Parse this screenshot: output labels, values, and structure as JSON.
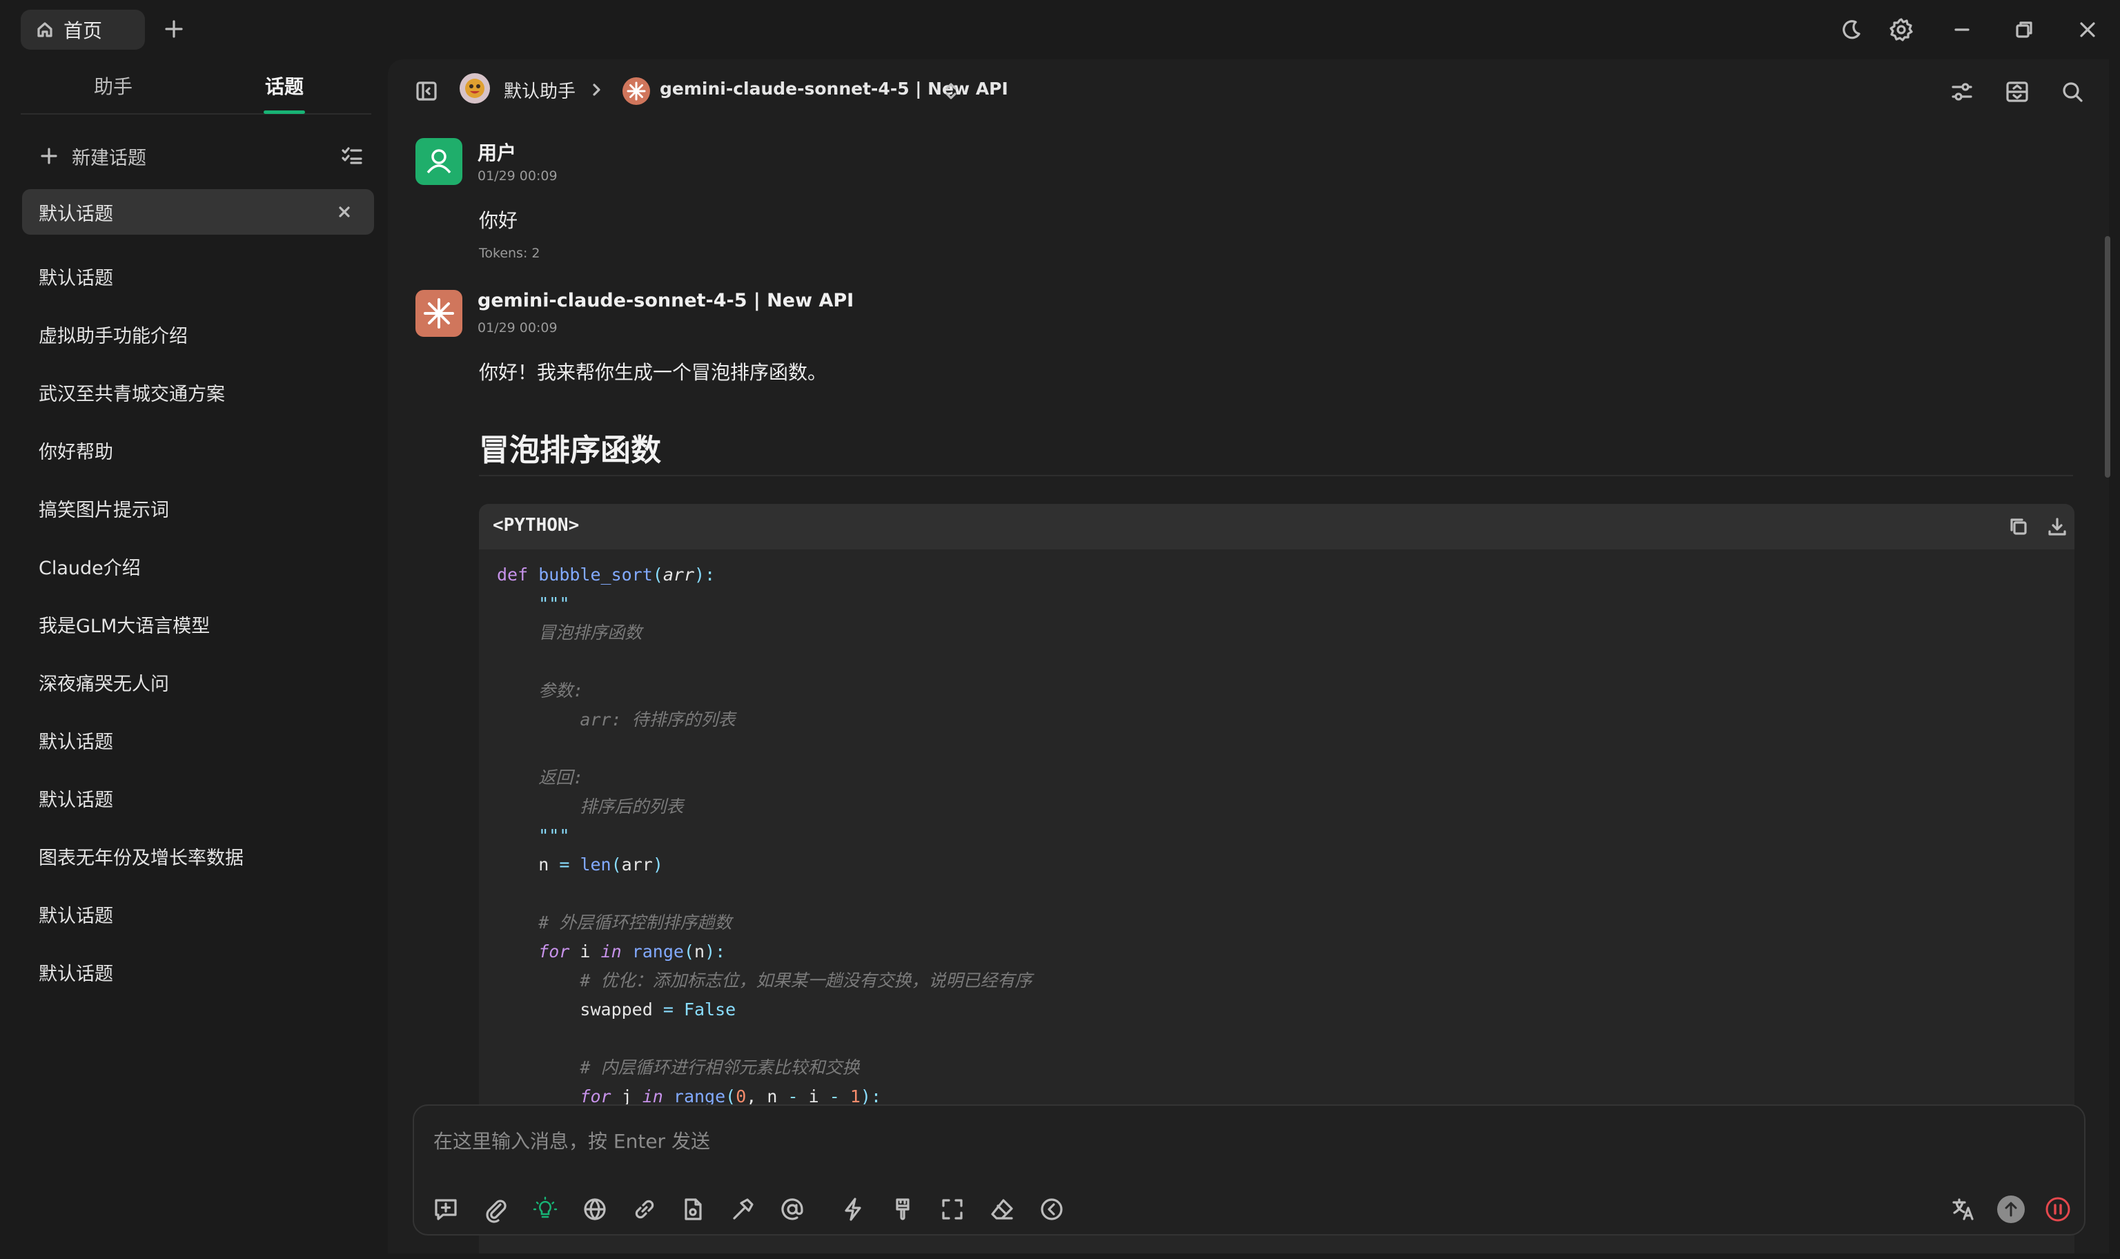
{
  "titlebar": {
    "home_tab_label": "首页",
    "icons": [
      "home-icon",
      "plus-icon",
      "moon-icon",
      "gear-icon",
      "minimize-icon",
      "restore-icon",
      "close-icon"
    ]
  },
  "sidebar": {
    "tabs": [
      {
        "label": "助手"
      },
      {
        "label": "话题",
        "active": true
      }
    ],
    "new_topic_label": "新建话题",
    "topics": [
      {
        "label": "默认话题",
        "active": true
      },
      {
        "label": "默认话题"
      },
      {
        "label": "虚拟助手功能介绍"
      },
      {
        "label": "武汉至共青城交通方案"
      },
      {
        "label": "你好帮助"
      },
      {
        "label": "搞笑图片提示词"
      },
      {
        "label": "Claude介绍"
      },
      {
        "label": "我是GLM大语言模型"
      },
      {
        "label": "深夜痛哭无人问"
      },
      {
        "label": "默认话题"
      },
      {
        "label": "默认话题"
      },
      {
        "label": "图表无年份及增长率数据"
      },
      {
        "label": "默认话题"
      },
      {
        "label": "默认话题"
      }
    ]
  },
  "header": {
    "assistant_name": "默认助手",
    "model_name": "gemini-claude-sonnet-4-5 | New API"
  },
  "messages": [
    {
      "role": "user",
      "name": "用户",
      "time": "01/29 00:09",
      "text": "你好",
      "tokens": "Tokens: 2"
    },
    {
      "role": "assistant",
      "name": "gemini-claude-sonnet-4-5 | New API",
      "time": "01/29 00:09",
      "text": "你好！我来帮你生成一个冒泡排序函数。"
    }
  ],
  "answer": {
    "heading": "冒泡排序函数",
    "code_language": "<PYTHON>",
    "code": {
      "fn_name": "bubble_sort",
      "param": "arr",
      "docstring": [
        "冒泡排序函数",
        "参数:",
        "arr: 待排序的列表",
        "返回:",
        "排序后的列表"
      ],
      "comments": [
        "# 外层循环控制排序趟数",
        "# 优化：添加标志位，如果某一趟没有交换，说明已经有序",
        "# 内层循环进行相邻元素比较和交换"
      ]
    }
  },
  "composer": {
    "placeholder": "在这里输入消息，按 Enter 发送"
  },
  "colors": {
    "accent": "#18b375",
    "user_avatar": "#1fae6b",
    "model_avatar": "#d0765c",
    "stop": "#e5484d"
  }
}
